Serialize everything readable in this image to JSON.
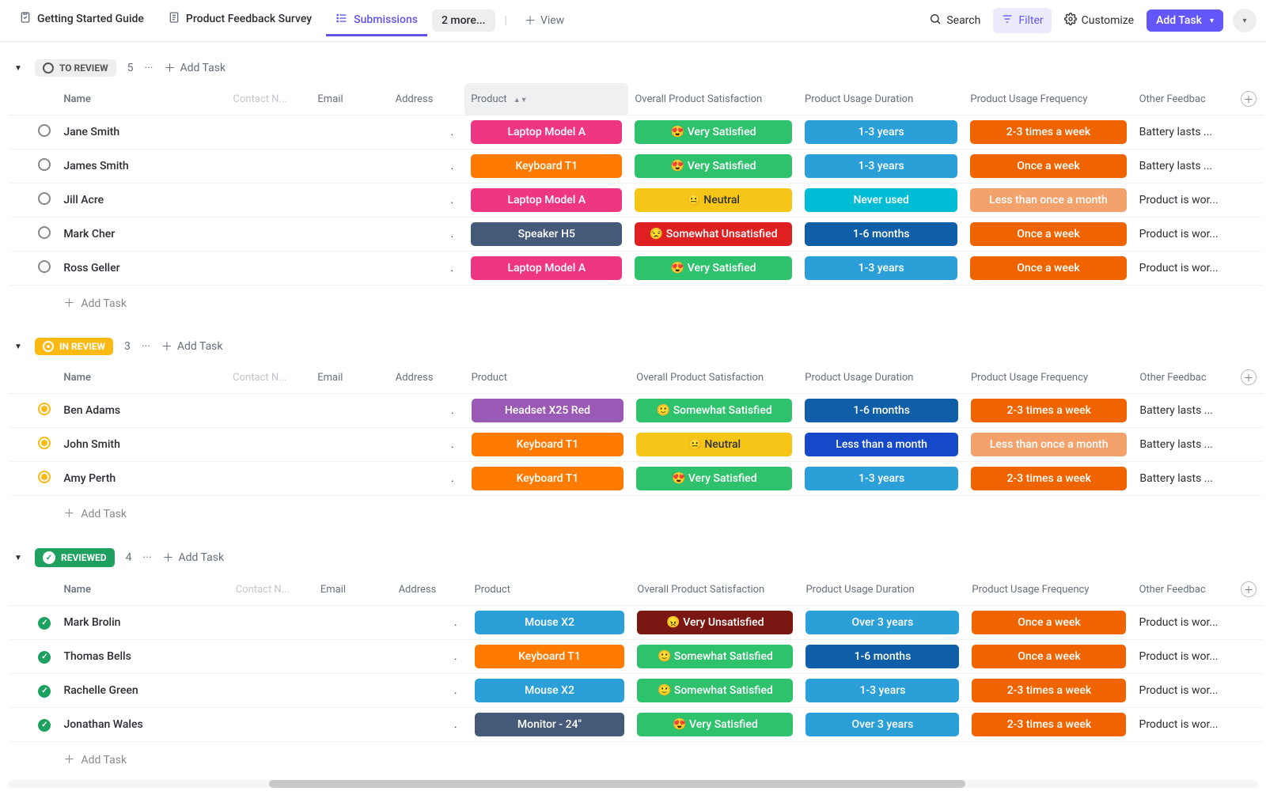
{
  "topnav": {
    "tabs": [
      {
        "label": "Getting Started Guide",
        "icon": "clipboard-check"
      },
      {
        "label": "Product Feedback Survey",
        "icon": "form"
      },
      {
        "label": "Submissions",
        "icon": "list"
      }
    ],
    "more_tabs": "2 more...",
    "plus_view": "View",
    "search": "Search",
    "filter": "Filter",
    "customize": "Customize",
    "add_task": "Add Task"
  },
  "columns": {
    "name": "Name",
    "contact": "Contact N...",
    "email": "Email",
    "address": "Address",
    "product": "Product",
    "satisfaction": "Overall Product Satisfaction",
    "duration": "Product Usage Duration",
    "frequency": "Product Usage Frequency",
    "feedback": "Other Feedbac"
  },
  "common": {
    "add_task": "Add Task",
    "address_dot": "."
  },
  "colors": {
    "pink": "#ef3682",
    "orange": "#ff7a00",
    "cyan": "#00bcd4",
    "blue": "#2a9fd8",
    "blue2": "#0f5ea8",
    "slate": "#455a79",
    "green": "#2ec26d",
    "yellow": "#f5c518",
    "red": "#e02020",
    "darkred": "#7a1712",
    "purple": "#9b59b6",
    "peach": "#f3a26b",
    "darkorange": "#f06400",
    "royalblue": "#1649c9"
  },
  "groups": [
    {
      "id": "toreview",
      "label": "TO REVIEW",
      "count": "5",
      "status_class": "status-toreview",
      "row_status": "ring-gray",
      "rows": [
        {
          "name": "Jane Smith",
          "product": {
            "text": "Laptop Model A",
            "color": "pink"
          },
          "sat": {
            "emoji": "😍",
            "text": "Very Satisfied",
            "color": "green"
          },
          "dur": {
            "text": "1-3 years",
            "color": "blue"
          },
          "freq": {
            "text": "2-3 times a week",
            "color": "darkorange"
          },
          "feedback": "Battery lasts ..."
        },
        {
          "name": "James Smith",
          "product": {
            "text": "Keyboard T1",
            "color": "orange"
          },
          "sat": {
            "emoji": "😍",
            "text": "Very Satisfied",
            "color": "green"
          },
          "dur": {
            "text": "1-3 years",
            "color": "blue"
          },
          "freq": {
            "text": "Once a week",
            "color": "darkorange"
          },
          "feedback": "Battery lasts ..."
        },
        {
          "name": "Jill Acre",
          "product": {
            "text": "Laptop Model A",
            "color": "pink"
          },
          "sat": {
            "emoji": "😐",
            "text": "Neutral",
            "color": "yellow"
          },
          "dur": {
            "text": "Never used",
            "color": "cyan"
          },
          "freq": {
            "text": "Less than once a month",
            "color": "peach"
          },
          "feedback": "Product is wor..."
        },
        {
          "name": "Mark Cher",
          "product": {
            "text": "Speaker H5",
            "color": "slate"
          },
          "sat": {
            "emoji": "😒",
            "text": "Somewhat Unsatisfied",
            "color": "red"
          },
          "dur": {
            "text": "1-6 months",
            "color": "blue2"
          },
          "freq": {
            "text": "Once a week",
            "color": "darkorange"
          },
          "feedback": "Product is wor..."
        },
        {
          "name": "Ross Geller",
          "product": {
            "text": "Laptop Model A",
            "color": "pink"
          },
          "sat": {
            "emoji": "😍",
            "text": "Very Satisfied",
            "color": "green"
          },
          "dur": {
            "text": "1-3 years",
            "color": "blue"
          },
          "freq": {
            "text": "Once a week",
            "color": "darkorange"
          },
          "feedback": "Product is wor..."
        }
      ]
    },
    {
      "id": "inreview",
      "label": "IN REVIEW",
      "count": "3",
      "status_class": "status-inreview",
      "row_status": "ring-yellow",
      "rows": [
        {
          "name": "Ben Adams",
          "product": {
            "text": "Headset X25 Red",
            "color": "purple"
          },
          "sat": {
            "emoji": "🙂",
            "text": "Somewhat Satisfied",
            "color": "green"
          },
          "dur": {
            "text": "1-6 months",
            "color": "blue2"
          },
          "freq": {
            "text": "2-3 times a week",
            "color": "darkorange"
          },
          "feedback": "Battery lasts ..."
        },
        {
          "name": "John Smith",
          "product": {
            "text": "Keyboard T1",
            "color": "orange"
          },
          "sat": {
            "emoji": "😐",
            "text": "Neutral",
            "color": "yellow"
          },
          "dur": {
            "text": "Less than a month",
            "color": "royalblue"
          },
          "freq": {
            "text": "Less than once a month",
            "color": "peach"
          },
          "feedback": "Battery lasts ..."
        },
        {
          "name": "Amy Perth",
          "product": {
            "text": "Keyboard T1",
            "color": "orange"
          },
          "sat": {
            "emoji": "😍",
            "text": "Very Satisfied",
            "color": "green"
          },
          "dur": {
            "text": "1-3 years",
            "color": "blue"
          },
          "freq": {
            "text": "2-3 times a week",
            "color": "darkorange"
          },
          "feedback": "Battery lasts ..."
        }
      ]
    },
    {
      "id": "reviewed",
      "label": "REVIEWED",
      "count": "4",
      "status_class": "status-reviewed",
      "row_status": "check-green",
      "rows": [
        {
          "name": "Mark Brolin",
          "product": {
            "text": "Mouse X2",
            "color": "blue"
          },
          "sat": {
            "emoji": "😠",
            "text": "Very Unsatisfied",
            "color": "darkred"
          },
          "dur": {
            "text": "Over 3 years",
            "color": "blue"
          },
          "freq": {
            "text": "Once a week",
            "color": "darkorange"
          },
          "feedback": "Product is wor..."
        },
        {
          "name": "Thomas Bells",
          "product": {
            "text": "Keyboard T1",
            "color": "orange"
          },
          "sat": {
            "emoji": "🙂",
            "text": "Somewhat Satisfied",
            "color": "green"
          },
          "dur": {
            "text": "1-6 months",
            "color": "blue2"
          },
          "freq": {
            "text": "Once a week",
            "color": "darkorange"
          },
          "feedback": "Product is wor..."
        },
        {
          "name": "Rachelle Green",
          "product": {
            "text": "Mouse X2",
            "color": "blue"
          },
          "sat": {
            "emoji": "🙂",
            "text": "Somewhat Satisfied",
            "color": "green"
          },
          "dur": {
            "text": "1-3 years",
            "color": "blue"
          },
          "freq": {
            "text": "2-3 times a week",
            "color": "darkorange"
          },
          "feedback": "Product is wor..."
        },
        {
          "name": "Jonathan Wales",
          "product": {
            "text": "Monitor - 24\"",
            "color": "slate"
          },
          "sat": {
            "emoji": "😍",
            "text": "Very Satisfied",
            "color": "green"
          },
          "dur": {
            "text": "Over 3 years",
            "color": "blue"
          },
          "freq": {
            "text": "2-3 times a week",
            "color": "darkorange"
          },
          "feedback": "Product is wor..."
        }
      ]
    }
  ]
}
